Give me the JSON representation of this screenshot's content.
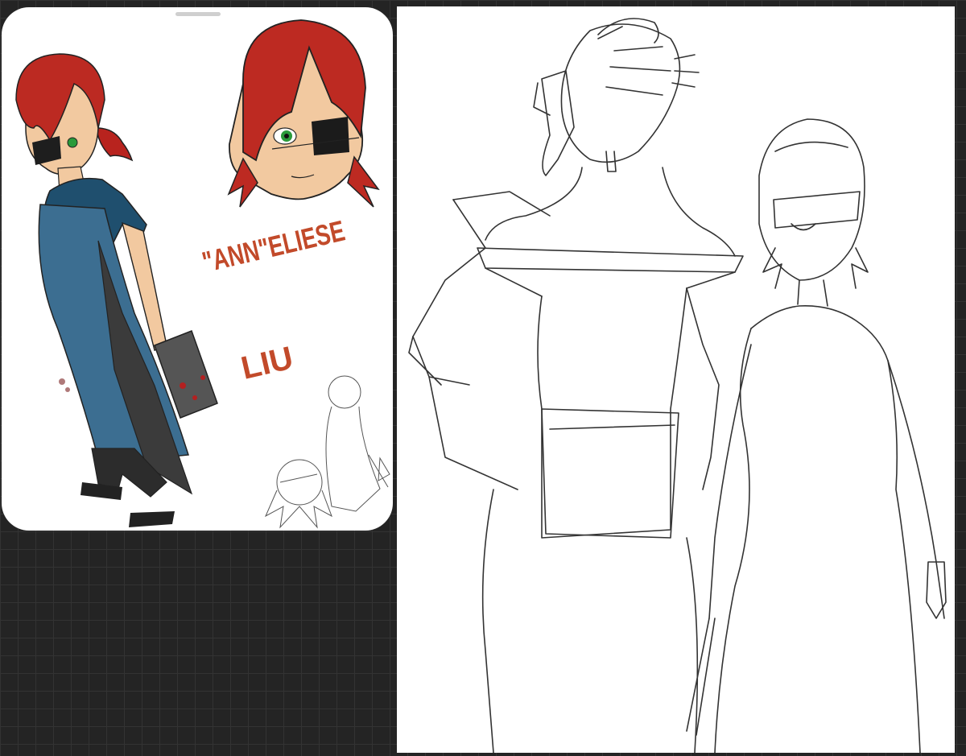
{
  "reference_card": {
    "name_line1": "\"ANN\"ELIESE",
    "name_line2": "LIU"
  }
}
